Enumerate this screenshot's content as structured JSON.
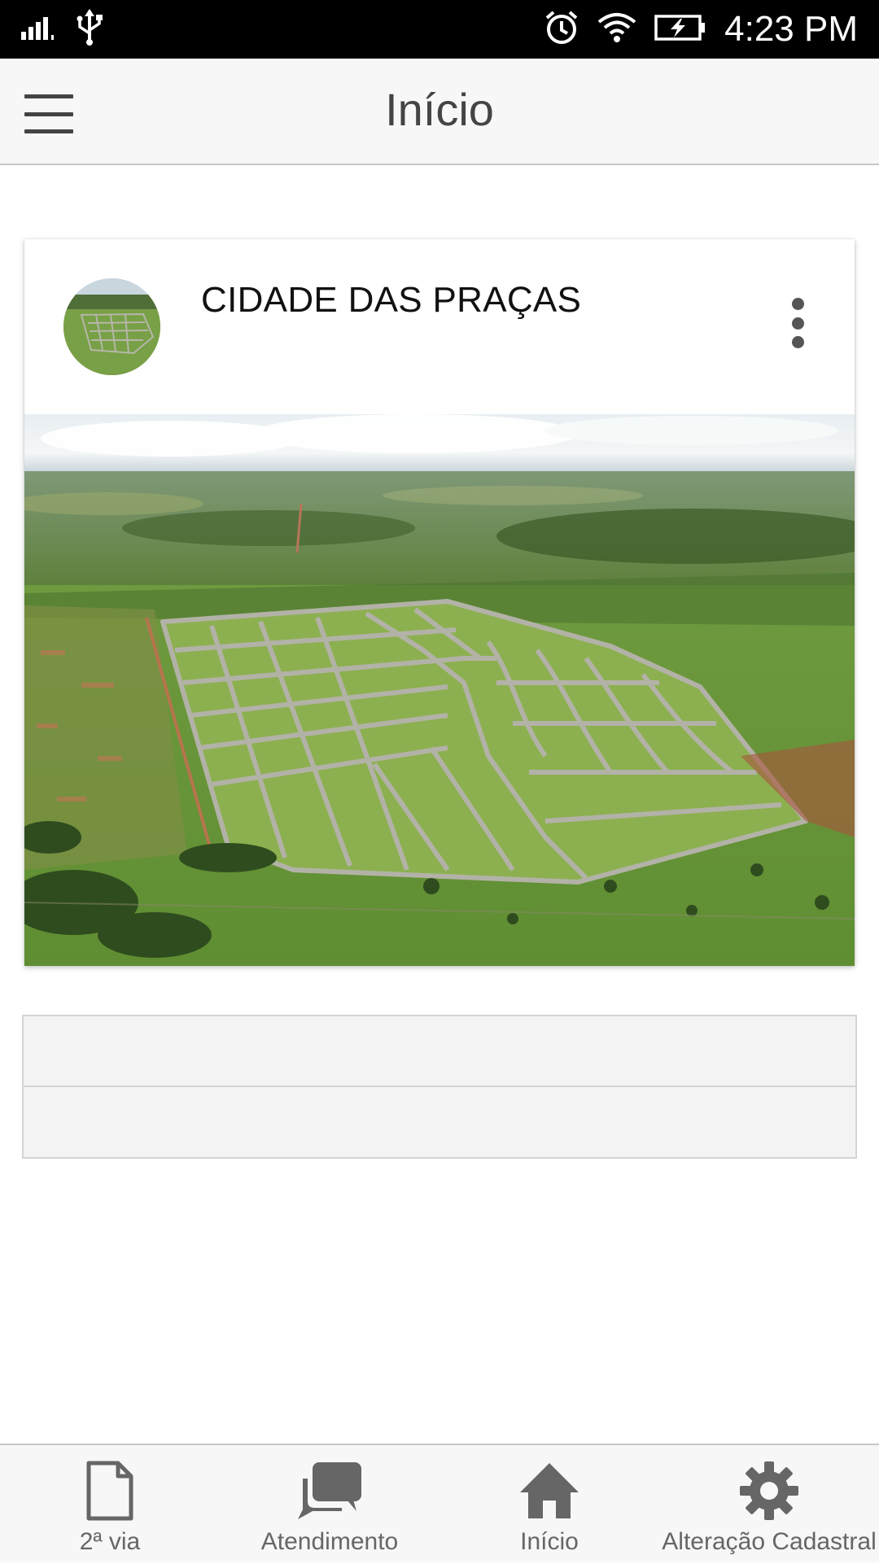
{
  "status_bar": {
    "time": "4:23 PM",
    "icons": [
      "signal-icon",
      "usb-icon",
      "alarm-icon",
      "wifi-icon",
      "battery-charging-icon"
    ]
  },
  "app_bar": {
    "title": "Início",
    "menu_icon": "hamburger-menu-icon"
  },
  "card": {
    "title": "CIDADE DAS PRAÇAS",
    "avatar": "aerial-subdivision-thumbnail",
    "more_icon": "more-vertical-icon",
    "image": "aerial-view-of-land-subdivision"
  },
  "list": {
    "rows": [
      "",
      ""
    ]
  },
  "bottom_nav": {
    "items": [
      {
        "label": "2ª via",
        "icon": "document-icon"
      },
      {
        "label": "Atendimento",
        "icon": "chat-bubbles-icon"
      },
      {
        "label": "Início",
        "icon": "home-icon"
      },
      {
        "label": "Alteração Cadastral",
        "icon": "gear-icon"
      }
    ]
  },
  "colors": {
    "status_bar_bg": "#000000",
    "app_bar_bg": "#f7f7f7",
    "icon_gray": "#666666",
    "title_text": "#444444"
  }
}
